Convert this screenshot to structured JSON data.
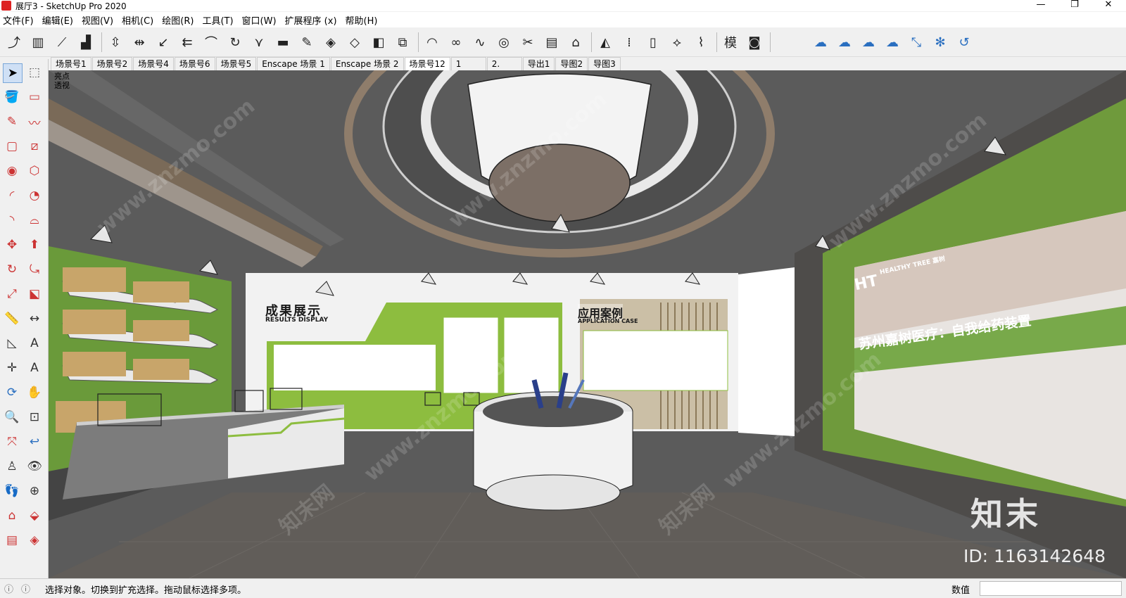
{
  "window": {
    "title": "展厅3 - SketchUp Pro 2020",
    "controls": [
      "—",
      "❐",
      "✕"
    ]
  },
  "menu": [
    "文件(F)",
    "编辑(E)",
    "视图(V)",
    "相机(C)",
    "绘图(R)",
    "工具(T)",
    "窗口(W)",
    "扩展程序 (x)",
    "帮助(H)"
  ],
  "toolbar_icons": [
    {
      "name": "follow-me-icon",
      "glyph": "⤴"
    },
    {
      "name": "columns-icon",
      "glyph": "▥"
    },
    {
      "name": "stair-icon",
      "glyph": "⟋"
    },
    {
      "name": "bar-steps-icon",
      "glyph": "▟"
    },
    {
      "name": "weld-icon",
      "glyph": "⇳"
    },
    {
      "name": "align-icon",
      "glyph": "⇹"
    },
    {
      "name": "arrow-curve-icon",
      "glyph": "↙"
    },
    {
      "name": "multi-arrow-icon",
      "glyph": "⇇"
    },
    {
      "name": "arch-icon",
      "glyph": "⌒"
    },
    {
      "name": "rotate-icon",
      "glyph": "↻"
    },
    {
      "name": "branch-icon",
      "glyph": "⋎"
    },
    {
      "name": "slab-icon",
      "glyph": "▬"
    },
    {
      "name": "pen-icon",
      "glyph": "✎"
    },
    {
      "name": "grid-diamond-icon",
      "glyph": "◈"
    },
    {
      "name": "grid-diamond2-icon",
      "glyph": "◇"
    },
    {
      "name": "box-3d-icon",
      "glyph": "◧"
    },
    {
      "name": "layer-icon",
      "glyph": "⧉"
    },
    {
      "name": "arc-icon",
      "glyph": "◠"
    },
    {
      "name": "chain-icon",
      "glyph": "∞"
    },
    {
      "name": "wave-icon",
      "glyph": "∿"
    },
    {
      "name": "spiral-icon",
      "glyph": "◎"
    },
    {
      "name": "cut-icon",
      "glyph": "✂"
    },
    {
      "name": "piano-icon",
      "glyph": "▤"
    },
    {
      "name": "temple-icon",
      "glyph": "⌂"
    },
    {
      "name": "mirror-icon",
      "glyph": "◭"
    },
    {
      "name": "dots-icon",
      "glyph": "⁞"
    },
    {
      "name": "door-icon",
      "glyph": "▯"
    },
    {
      "name": "compass-icon",
      "glyph": "⟡"
    },
    {
      "name": "brush-icon",
      "glyph": "⌇"
    },
    {
      "name": "model-icon",
      "glyph": "模"
    },
    {
      "name": "camera-box-icon",
      "glyph": "◙"
    },
    {
      "name": "cloud-link-icon",
      "glyph": "☁"
    },
    {
      "name": "cloud-share-icon",
      "glyph": "☁"
    },
    {
      "name": "cloud-check-icon",
      "glyph": "☁"
    },
    {
      "name": "cloud-list-icon",
      "glyph": "☁"
    },
    {
      "name": "resize-icon",
      "glyph": "⤡"
    },
    {
      "name": "network-icon",
      "glyph": "✻"
    },
    {
      "name": "refresh-check-icon",
      "glyph": "↺"
    }
  ],
  "scenes": [
    "场景号1",
    "场景号2",
    "场景号4",
    "场景号6",
    "场景号5",
    "Enscape 场景 1",
    "Enscape 场景 2",
    "场景号12",
    "1",
    "2.",
    "导出1",
    "导图2",
    "导图3"
  ],
  "viewport": {
    "label_line1": "亮点",
    "label_line2": "透视",
    "sign_results_cn": "成果展示",
    "sign_results_en": "RESULTS DISPLAY",
    "sign_app_cn": "应用案例",
    "sign_app_en": "APPLICATION CASE",
    "banner_logo": "HT",
    "banner_logo_sub": "HEALTHY TREE 嘉树",
    "banner_text": "苏州嘉树医疗：自我给药装置",
    "watermark_site": "www.znzmo.com",
    "watermark_cn": "知末网",
    "brand_big": "知末",
    "brand_id": "ID: 1163142648"
  },
  "status": {
    "message": "选择对象。切换到扩充选择。拖动鼠标选择多项。",
    "vcb_label": "数值"
  },
  "left_tools": [
    "select-icon",
    "component-icon",
    "paint-bucket-icon",
    "eraser-icon",
    "pencil-icon",
    "freehand-icon",
    "rectangle-icon",
    "rotated-rectangle-icon",
    "circle-icon",
    "polygon-icon",
    "arc-icon",
    "pie-icon",
    "arc3-icon",
    "two-point-arc-icon",
    "move-icon",
    "push-pull-icon",
    "rotate-icon",
    "follow-me-icon",
    "scale-icon",
    "offset-icon",
    "tape-measure-icon",
    "dimension-icon",
    "protractor-icon",
    "text-icon",
    "axes-icon",
    "3d-text-icon",
    "orbit-icon",
    "pan-icon",
    "zoom-icon",
    "zoom-window-icon",
    "zoom-extents-icon",
    "previous-view-icon",
    "position-camera-icon",
    "look-around-icon",
    "walk-icon",
    "section-plane-icon",
    "warehouse-icon",
    "extension-icon",
    "layout-icon",
    "style-icon"
  ]
}
